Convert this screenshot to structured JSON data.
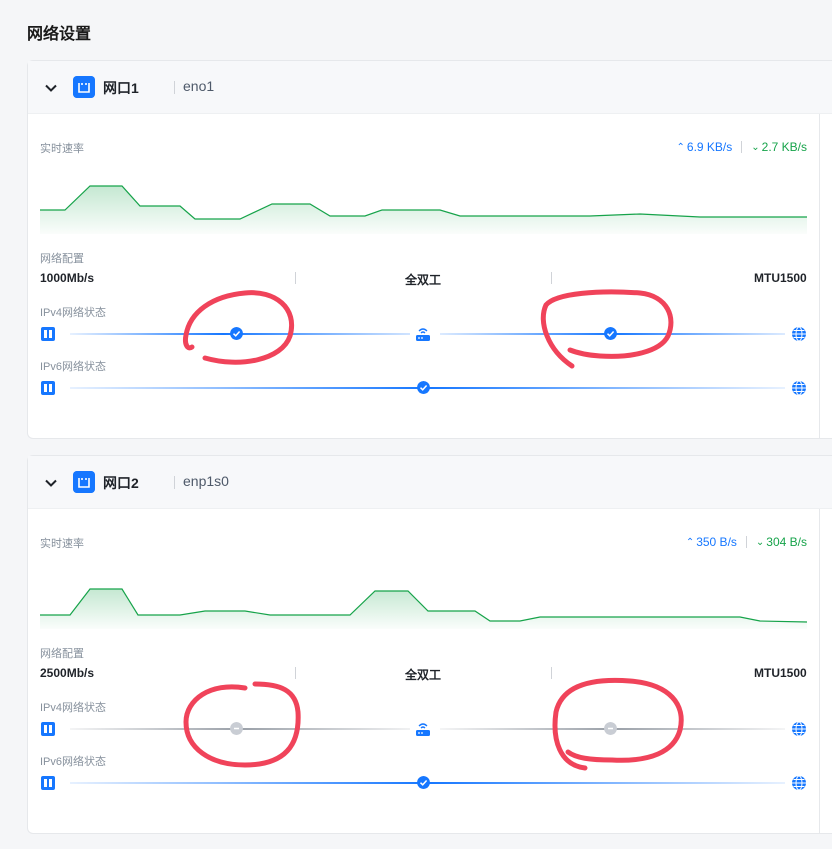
{
  "page": {
    "title": "网络设置"
  },
  "labels": {
    "speed": "实时速率",
    "config": "网络配置",
    "ipv4": "IPv4网络状态",
    "ipv6": "IPv6网络状态"
  },
  "ports": [
    {
      "name": "网口1",
      "device": "eno1",
      "upload": "6.9 KB/s",
      "download": "2.7 KB/s",
      "speed": "1000Mb/s",
      "duplex": "全双工",
      "mtu": "MTU1500",
      "ipv4_wan_ok": true,
      "ipv4_lan_ok": true,
      "ipv6_ok": true
    },
    {
      "name": "网口2",
      "device": "enp1s0",
      "upload": "350 B/s",
      "download": "304 B/s",
      "speed": "2500Mb/s",
      "duplex": "全双工",
      "mtu": "MTU1500",
      "ipv4_wan_ok": false,
      "ipv4_lan_ok": false,
      "ipv6_ok": true
    }
  ],
  "colors": {
    "accent": "#1677ff",
    "download": "#16a34a",
    "inactive": "#c9cdd4",
    "annotation": "#f0435a"
  },
  "icons": {
    "expand": "chevron-down-icon",
    "port": "ethernet-port-icon",
    "lan": "lan-port-icon",
    "router": "router-icon",
    "internet": "globe-icon",
    "ok": "check-circle-icon"
  }
}
